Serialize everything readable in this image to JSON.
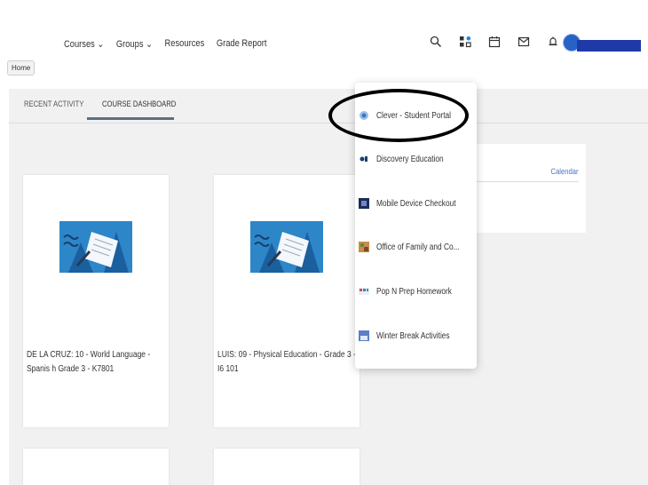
{
  "header": {
    "nav": [
      "Courses ⌄",
      "Groups ⌄",
      "Resources",
      "Grade Report"
    ],
    "home_tooltip": "Home",
    "icons": [
      "search-icon",
      "apps-icon",
      "calendar-icon",
      "mail-icon",
      "bell-icon"
    ]
  },
  "tabs": [
    {
      "label": "RECENT ACTIVITY",
      "active": false
    },
    {
      "label": "COURSE DASHBOARD",
      "active": true
    }
  ],
  "courses": [
    {
      "title": "DE LA CRUZ: 10 - World Language - Spanis h Grade 3 - K7801"
    },
    {
      "title": "LUIS: 09 - Physical Education - Grade 3 - I6 101"
    }
  ],
  "calendar": {
    "label": "Calendar"
  },
  "apps_menu": [
    {
      "label": "Clever - Student Portal",
      "icon": "clever-icon"
    },
    {
      "label": "Discovery Education",
      "icon": "discovery-icon"
    },
    {
      "label": "Mobile Device Checkout",
      "icon": "device-icon"
    },
    {
      "label": "Office of Family and Co...",
      "icon": "family-icon"
    },
    {
      "label": "Pop N Prep Homework",
      "icon": "popnprep-icon"
    },
    {
      "label": "Winter Break Activities",
      "icon": "winter-icon"
    }
  ],
  "colors": {
    "accent": "#2d86c8",
    "user_bar": "#1f3aa8",
    "link": "#4a74c9"
  }
}
